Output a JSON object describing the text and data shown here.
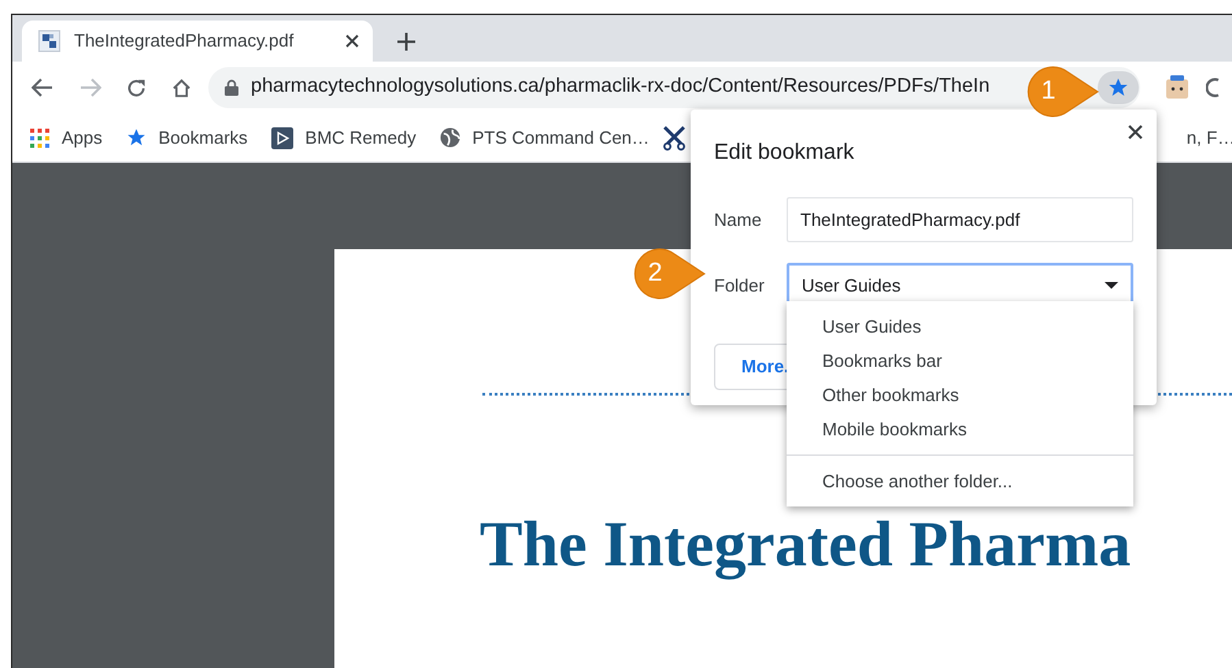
{
  "tab": {
    "title": "TheIntegratedPharmacy.pdf"
  },
  "toolbar": {
    "url": "pharmacytechnologysolutions.ca/pharmaclik-rx-doc/Content/Resources/PDFs/TheIn",
    "bookmarked": true
  },
  "bookmarks_bar": [
    {
      "label": "Apps",
      "kind": "apps"
    },
    {
      "label": "Bookmarks",
      "kind": "star"
    },
    {
      "label": "BMC Remedy",
      "kind": "play"
    },
    {
      "label": "PTS Command Cen…",
      "kind": "globe"
    },
    {
      "kind": "scissors"
    },
    {
      "label": "n, F…",
      "kind": "text"
    }
  ],
  "pdf": {
    "heading": "The Integrated Pharma"
  },
  "dialog": {
    "title": "Edit bookmark",
    "fields": [
      {
        "label": "Name",
        "value": "TheIntegratedPharmacy.pdf",
        "kind": "text",
        "focused": false
      },
      {
        "label": "Folder",
        "value": "User Guides",
        "kind": "select",
        "focused": true
      }
    ],
    "more_button": "More."
  },
  "folder_menu": {
    "options": [
      "User Guides",
      "Bookmarks bar",
      "Other bookmarks",
      "Mobile bookmarks"
    ],
    "footer": "Choose another folder..."
  },
  "callouts": [
    {
      "number": "1"
    },
    {
      "number": "2"
    }
  ]
}
